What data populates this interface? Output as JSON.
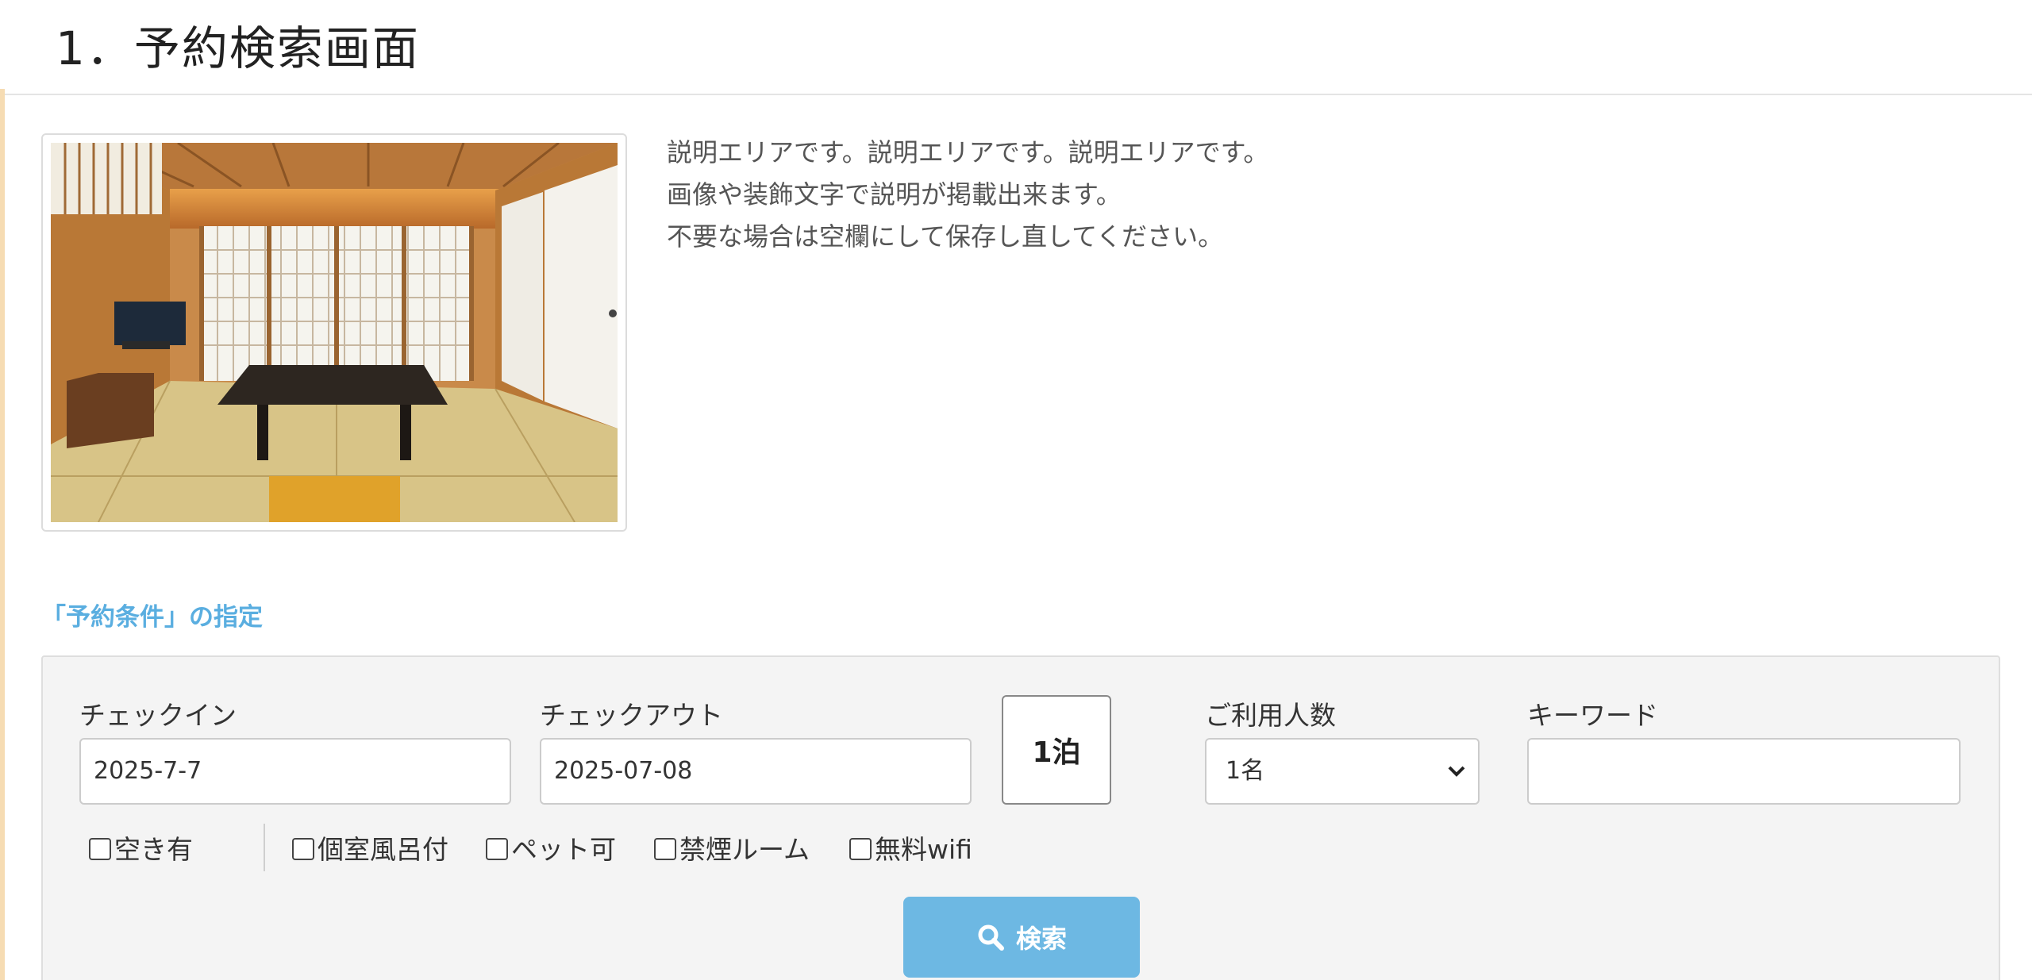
{
  "page": {
    "title": "1．予約検索画面"
  },
  "intro": {
    "lines": [
      "説明エリアです。説明エリアです。説明エリアです。",
      "画像や装飾文字で説明が掲載出来ます。",
      "不要な場合は空欄にして保存し直してください。"
    ]
  },
  "section": {
    "heading": "「予約条件」の指定"
  },
  "search": {
    "checkin_label": "チェックイン",
    "checkin_value": "2025-7-7",
    "checkout_label": "チェックアウト",
    "checkout_value": "2025-07-08",
    "nights": "1泊",
    "guests_label": "ご利用人数",
    "guests_value": "1名",
    "keyword_label": "キーワード",
    "keyword_value": "",
    "filters": [
      "空き有",
      "個室風呂付",
      "ペット可",
      "禁煙ルーム",
      "無料wifi"
    ],
    "button_label": "検索"
  },
  "colors": {
    "accent": "#5aaee0",
    "button": "#6db8e3",
    "panel": "#f4f4f4",
    "left_accent": "#f6dcb3"
  },
  "icons": {
    "search_button": "search-icon",
    "select": "chevron-down-icon"
  }
}
